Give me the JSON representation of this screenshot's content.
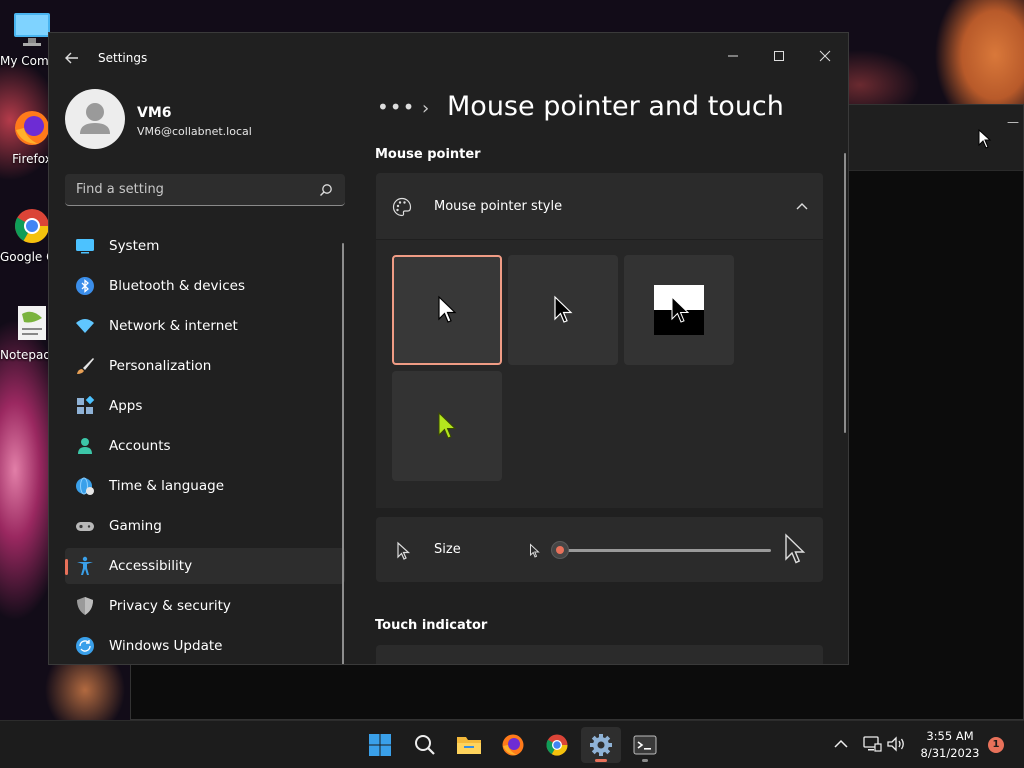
{
  "desktop": {
    "icons": [
      {
        "label": "My Computer",
        "icon": "monitor-icon"
      },
      {
        "label": "Firefox",
        "icon": "firefox-icon"
      },
      {
        "label": "Google Chrome",
        "icon": "chrome-icon"
      },
      {
        "label": "Notepad++",
        "icon": "notepad-icon"
      }
    ]
  },
  "window": {
    "app_title": "Settings",
    "controls": {
      "minimize": "minimize-icon",
      "maximize": "maximize-icon",
      "close": "close-icon"
    }
  },
  "user": {
    "name": "VM6",
    "email": "VM6@collabnet.local"
  },
  "search": {
    "placeholder": "Find a setting",
    "value": ""
  },
  "sidebar": {
    "items": [
      {
        "label": "System",
        "icon": "system-icon",
        "color": "#4cc2ff"
      },
      {
        "label": "Bluetooth & devices",
        "icon": "bluetooth-icon",
        "color": "#3b8eea"
      },
      {
        "label": "Network & internet",
        "icon": "wifi-icon",
        "color": "#60c6ff"
      },
      {
        "label": "Personalization",
        "icon": "brush-icon",
        "color": "#e8a055"
      },
      {
        "label": "Apps",
        "icon": "apps-icon",
        "color": "#8fb2d6"
      },
      {
        "label": "Accounts",
        "icon": "person-icon",
        "color": "#3cc6a8"
      },
      {
        "label": "Time & language",
        "icon": "globe-clock-icon",
        "color": "#3aa0ea"
      },
      {
        "label": "Gaming",
        "icon": "gamepad-icon",
        "color": "#b8b8b8"
      },
      {
        "label": "Accessibility",
        "icon": "accessibility-icon",
        "color": "#3aa0ea",
        "selected": true
      },
      {
        "label": "Privacy & security",
        "icon": "shield-icon",
        "color": "#9a9a9a"
      },
      {
        "label": "Windows Update",
        "icon": "update-icon",
        "color": "#3aa0ea"
      }
    ]
  },
  "main": {
    "breadcrumb_dots": "•••",
    "breadcrumb_chevron": "›",
    "title": "Mouse pointer and touch",
    "section_pointer": "Mouse pointer",
    "pointer_style": {
      "label": "Mouse pointer style",
      "expanded": true,
      "options": [
        {
          "name": "white",
          "selected": true
        },
        {
          "name": "black",
          "selected": false
        },
        {
          "name": "inverted",
          "selected": false
        },
        {
          "name": "custom-lime",
          "selected": false,
          "color": "#b4e61e"
        }
      ]
    },
    "size": {
      "label": "Size",
      "value": 1,
      "min": 1,
      "max": 15
    },
    "section_touch": "Touch indicator"
  },
  "taskbar": {
    "apps": [
      {
        "icon": "start-icon"
      },
      {
        "icon": "search-icon"
      },
      {
        "icon": "file-explorer-icon"
      },
      {
        "icon": "firefox-icon"
      },
      {
        "icon": "chrome-icon"
      },
      {
        "icon": "settings-icon",
        "active": true
      },
      {
        "icon": "terminal-icon",
        "running": true
      }
    ],
    "clock_time": "3:55 AM",
    "clock_date": "8/31/2023",
    "notification_count": "1"
  },
  "colors": {
    "accent": "#e8715a",
    "window_bg": "#202020",
    "card_bg": "#2b2b2b",
    "selected_tile_border": "#f09c85"
  }
}
